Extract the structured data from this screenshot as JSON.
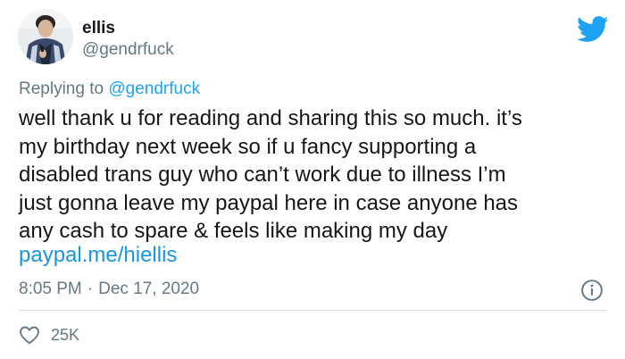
{
  "author": {
    "display_name": "ellis",
    "handle": "@gendrfuck"
  },
  "reply": {
    "prefix": "Replying to",
    "handle": "@gendrfuck"
  },
  "tweet": {
    "text": "well thank u for reading and sharing this so much. it’s\nmy birthday next week so if u fancy supporting a\ndisabled trans guy who can’t work due to illness I’m\njust gonna leave my paypal here in case anyone has\nany cash to spare & feels like making my day",
    "link": "paypal.me/hiellis",
    "time": "8:05 PM",
    "separator": "·",
    "date": "Dec 17, 2020"
  },
  "actions": {
    "likes": "25K"
  },
  "icons": {
    "platform": "twitter-bird-icon",
    "info": "info-icon",
    "like": "heart-icon"
  },
  "colors": {
    "brand": "#1da1f2",
    "link": "#1b95e0",
    "muted": "#657786",
    "text": "#14171a"
  }
}
